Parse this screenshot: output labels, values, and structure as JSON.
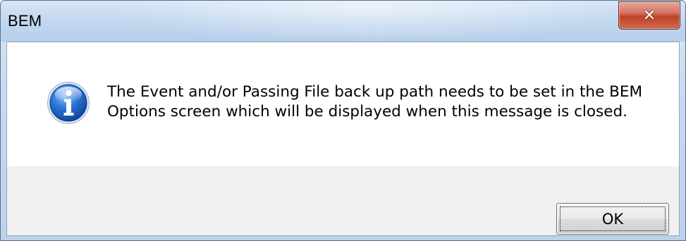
{
  "window": {
    "title": "BEM"
  },
  "titlebar": {
    "close_icon": "close-icon",
    "close_glyph": "✕"
  },
  "message": {
    "icon": "info-icon",
    "line1": "The Event and/or Passing File back up path needs to be set in the BEM",
    "line2": "Options screen which will be displayed when this message is closed."
  },
  "buttons": {
    "ok_label": "OK"
  },
  "colors": {
    "close_button": "#c7432b",
    "info_icon": "#1f5fbf",
    "button_area": "#f0f0f0"
  }
}
